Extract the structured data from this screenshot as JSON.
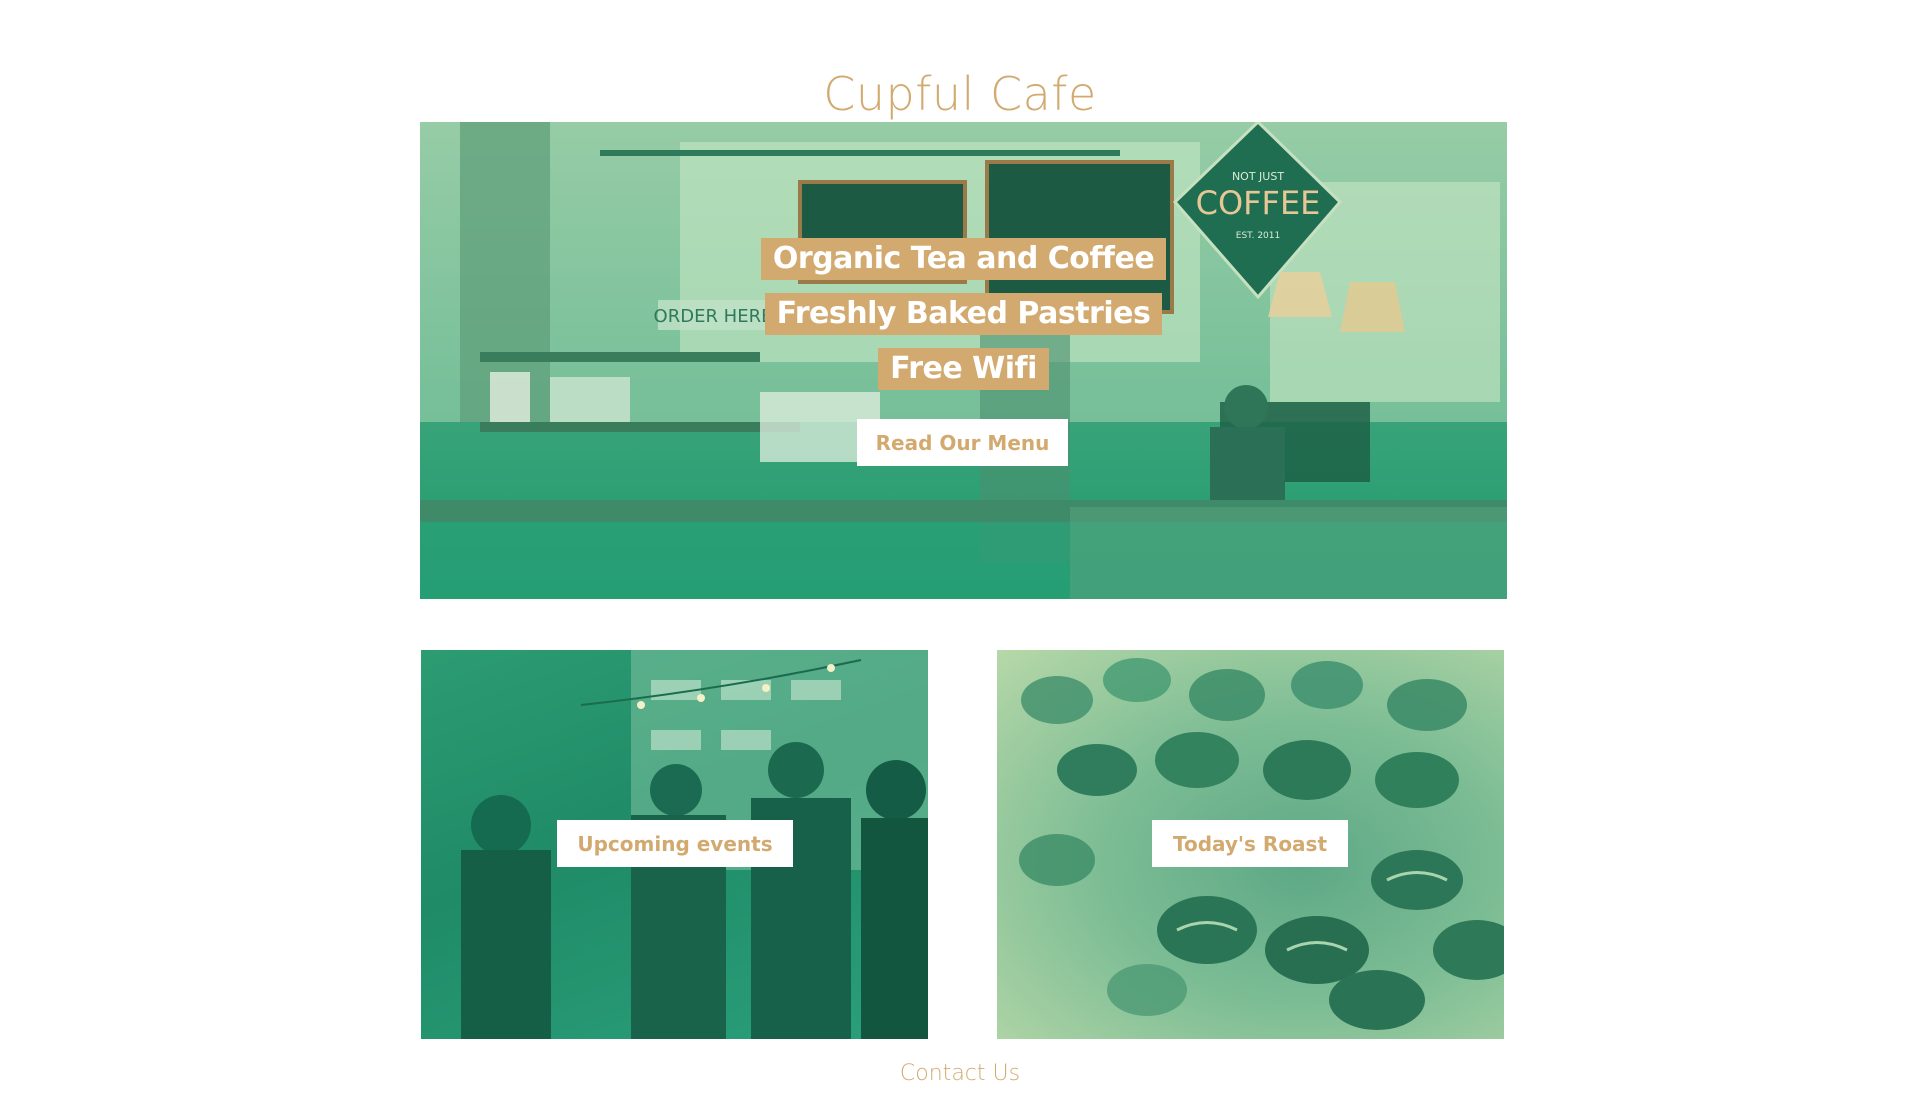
{
  "site": {
    "title": "Cupful Cafe"
  },
  "hero": {
    "taglines": [
      "Organic Tea and Coffee",
      "Freshly Baked Pastries",
      "Free Wifi"
    ],
    "menu_button": "Read Our Menu",
    "scene_text": {
      "order_sign": "ORDER HERE",
      "coffee_sign_top": "NOT JUST",
      "coffee_sign_main": "COFFEE",
      "coffee_sign_bottom": "EST. 2011"
    }
  },
  "features": {
    "events_button": "Upcoming events",
    "roast_button": "Today's Roast"
  },
  "footer": {
    "contact": "Contact Us"
  },
  "colors": {
    "accent": "#d2aa70",
    "overlay_green": "#1f9a6d",
    "background": "#ffffff"
  }
}
